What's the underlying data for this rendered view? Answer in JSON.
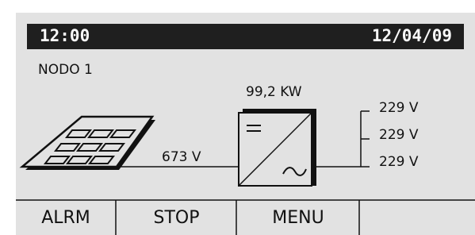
{
  "status_bar": {
    "time": "12:00",
    "date": "12/04/09"
  },
  "node": {
    "title": "NODO 1"
  },
  "diagram": {
    "power": "99,2 KW",
    "dc_voltage": "673 V",
    "ac_voltages": [
      "229 V",
      "229 V",
      "229 V"
    ]
  },
  "softkeys": [
    "ALRM",
    "STOP",
    "MENU",
    ""
  ],
  "colors": {
    "screen_bg": "#e2e2e2",
    "bar_bg": "#1f1f1f",
    "ink": "#111111"
  },
  "icons": [
    "solar-panel-icon",
    "inverter-icon"
  ]
}
